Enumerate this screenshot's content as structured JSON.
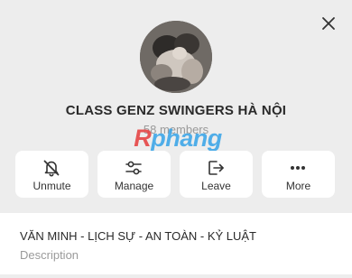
{
  "header": {
    "close_icon": "close-icon"
  },
  "group": {
    "avatar_icon": "group-avatar-photo",
    "name": "CLASS GENZ SWINGERS HÀ NỘI",
    "members": "58 members"
  },
  "watermark": {
    "first_letter": "R",
    "rest": "phang"
  },
  "actions": [
    {
      "label": "Unmute",
      "icon": "bell-off-icon"
    },
    {
      "label": "Manage",
      "icon": "sliders-icon"
    },
    {
      "label": "Leave",
      "icon": "exit-icon"
    },
    {
      "label": "More",
      "icon": "more-dots-icon"
    }
  ],
  "description": {
    "text": "VĂN MINH - LỊCH SỰ - AN TOÀN - KỶ LUẬT",
    "label": "Description"
  },
  "colors": {
    "background": "#ededed",
    "card": "#ffffff",
    "text": "#2c2c2c",
    "muted": "#9a9a9a",
    "watermark_red": "#e64545",
    "watermark_blue": "#3fa7e8"
  }
}
